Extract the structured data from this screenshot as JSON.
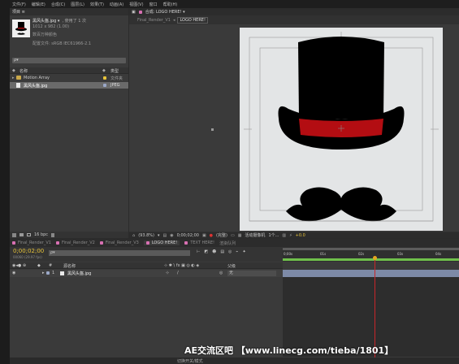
{
  "menu": [
    "文件(F)",
    "编辑(E)",
    "合成(C)",
    "图层(L)",
    "效果(T)",
    "动画(A)",
    "视图(V)",
    "窗口",
    "帮助(H)"
  ],
  "project": {
    "tab_label": "项目 ≡",
    "file_name": "黑风头盔.jpg ▾",
    "used_count": ", 使用了 1 次",
    "dimensions": "1012 x 982 (1.00)",
    "color_depth": "数百万种颜色",
    "color_profile": "配置文件: sRGB IEC61966-2.1",
    "search_placeholder": "ρ▾",
    "col_name": "名称",
    "col_type": "类型",
    "items": [
      {
        "name": "Motion Array",
        "type": "文件夹"
      },
      {
        "name": "黑风头盔.jpg",
        "type": "JPEG"
      }
    ],
    "footer_bpc": "16 bpc"
  },
  "viewer": {
    "tab_label": "合成: LOGO HERE! ▾",
    "sub_tabs": [
      "Final_Render_V1",
      "LOGO HERE!"
    ],
    "active_sub_tab": "LOGO HERE!",
    "zoom": "(93.8%)",
    "timecode": "0;00;02;00",
    "resolution": "(完整)",
    "camera": "活动摄像机",
    "view_count": "1个...",
    "exposure": "+0.0"
  },
  "timeline": {
    "tabs": [
      "Final_Render_V1",
      "Final_Render_V2",
      "Final_Render_V3",
      "LOGO HERE!",
      "TEXT HERE!",
      "渲染队列"
    ],
    "active_tab": "LOGO HERE!",
    "timecode": "0;00;02;00",
    "fps": "00060 (29.97 fps)",
    "search_placeholder": "ρ▾",
    "col_source": "源名称",
    "col_parent": "父级",
    "layer_index": "1",
    "layer_name": "黑风头盔.jpg",
    "parent_value": "无",
    "ruler": [
      "0;00s",
      "01s",
      "02s",
      "03s",
      "04s"
    ],
    "bottom_status": "切换开关/模式"
  },
  "watermark": "AE交流区吧 【www.linecg.com/tieba/1801】",
  "colors": {
    "label_yellow": "#e7c33a",
    "label_pink": "#d870b3",
    "playhead_red": "#c8262a",
    "work_area_green": "#6fc04b",
    "hat_band_red": "#b30d12"
  }
}
